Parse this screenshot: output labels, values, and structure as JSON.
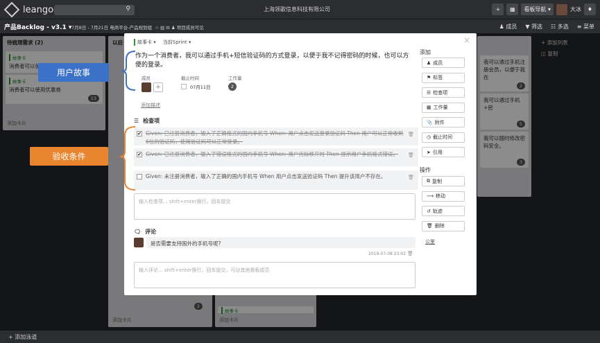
{
  "topbar": {
    "logo_text": "leangoo",
    "company": "上海领歌信息科技有限公司",
    "nav_label": "看板导航",
    "user_name": "大冰",
    "plus": "+",
    "grid": "▦",
    "bell": "🔔"
  },
  "subbar": {
    "title": "产品Backlog - v3.1",
    "sprint_range": "7月8日 - 7月21日 电商平台-产品规划组",
    "members_visible": "项目成员可见",
    "members": "成员",
    "filter": "筛选",
    "multi": "多选",
    "menu": "菜单"
  },
  "board": {
    "col1": {
      "title": "待梳理需求 (2)",
      "cards": [
        {
          "tag": "故事卡",
          "text": "消费者可以使用支付宝支付"
        },
        {
          "tag": "故事卡",
          "text": "消费者可以使用优惠券",
          "count": "13"
        }
      ],
      "add": "添加卡片"
    },
    "col2": {
      "title": "以后",
      "add": "添加卡片",
      "count": "2"
    },
    "col3": {
      "tag": "故事卡",
      "add": "添加卡片"
    },
    "col4": {
      "add_list": "+ 添加列表",
      "copy": "复制",
      "cards": [
        {
          "text": "我可以通过手机注册会员，以便于我在",
          "count": "2"
        },
        {
          "text": "我可以通过手机+密",
          "count": "5"
        },
        {
          "text": "我可以随时修改密码安全。",
          "count": "3"
        }
      ]
    },
    "add_lane": "+ 添加泳道"
  },
  "modal": {
    "card_type": "故事卡",
    "sprint": "当前Sprint",
    "story": "作为一个消费者，我可以通过手机+短信验证码的方式登录，以便于我不记得密码的时候，也可以方便的登录。",
    "members_label": "成员",
    "due_label": "截止时间",
    "due_value": "07月11日",
    "workload_label": "工作量",
    "workload_value": "2",
    "add_desc": "添加描述",
    "checklist_title": "检查项",
    "checklist": [
      {
        "text": "Given: 已注册消费者，输入了正确格式的国内手机号 When: 用户点击发送登录验证码 Then 用户可以正常收到6位的验证码，使用验证码可以正常登录。",
        "done": true
      },
      {
        "text": "Given: 已注册消费者，输入了错误格式的国内手机号 When: 用户光标移开时 Then 提示用户手机格式错误。",
        "done": true
      },
      {
        "text": "Given: 未注册消费者，输入了正确的国内手机号 When 用户点击发送验证码 Then 提升该用户不存在。",
        "done": false
      }
    ],
    "checklist_placeholder": "输入检查项... shift+enter换行，回车提交",
    "comment_title": "评论",
    "comment_text": "是否需要支持国外的手机号呢?",
    "comment_time": "2019-07-08 23:02",
    "comment_placeholder": "输入评论... shift+enter换行，回车提交，可@其他看板成员",
    "add_section": "添加",
    "add_buttons": [
      "成员",
      "标签",
      "检查项",
      "工作量",
      "附件",
      "截止时间",
      "引用"
    ],
    "actions_section": "操作",
    "action_buttons": [
      "复制",
      "移动",
      "轨迹",
      "删除"
    ],
    "share": "公里",
    "close": "×"
  },
  "callouts": {
    "user_story": "用户故事",
    "acceptance": "验收条件"
  },
  "colors": {
    "bracket_blue": "#3b72c7",
    "bracket_orange": "#e8852e",
    "tag_green": "#2a9a2a"
  }
}
